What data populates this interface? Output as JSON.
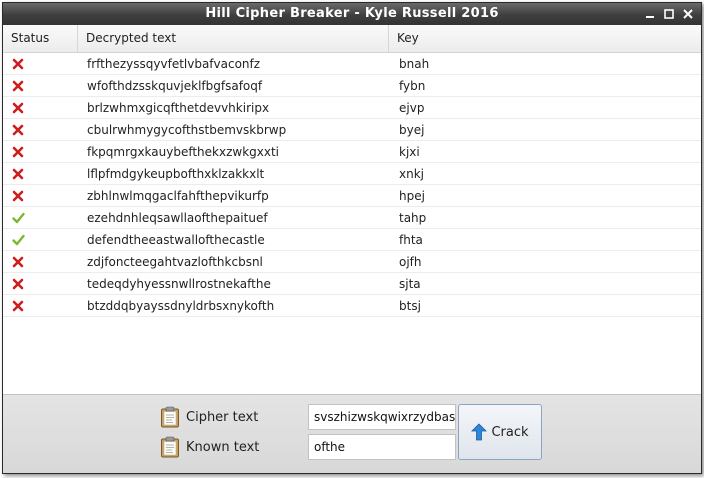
{
  "window": {
    "title": "Hill Cipher Breaker - Kyle Russell 2016"
  },
  "table": {
    "headers": {
      "status": "Status",
      "decrypted": "Decrypted text",
      "key": "Key"
    },
    "rows": [
      {
        "status": "fail",
        "decrypted": "frfthezyssqyvfetlvbafvaconfz",
        "key": "bnah"
      },
      {
        "status": "fail",
        "decrypted": "wfofthdzsskquvjeklfbgfsafoqf",
        "key": "fybn"
      },
      {
        "status": "fail",
        "decrypted": "brlzwhmxgicqfthetdevvhkiripx",
        "key": "ejvp"
      },
      {
        "status": "fail",
        "decrypted": "cbulrwhmygycofthstbemvskbrwp",
        "key": "byej"
      },
      {
        "status": "fail",
        "decrypted": "fkpqmrgxkauybefthekxzwkgxxti",
        "key": "kjxi"
      },
      {
        "status": "fail",
        "decrypted": "lflpfmdgykeupbofthxklzakkxlt",
        "key": "xnkj"
      },
      {
        "status": "fail",
        "decrypted": "zbhlnwlmqgaclfahfthepvikurfp",
        "key": "hpej"
      },
      {
        "status": "success",
        "decrypted": "ezehdnhleqsawllaofthepaituef",
        "key": "tahp"
      },
      {
        "status": "success",
        "decrypted": "defendtheeastwallofthecastle",
        "key": "fhta"
      },
      {
        "status": "fail",
        "decrypted": "zdjfoncteegahtvazlofthkcbsnl",
        "key": "ojfh"
      },
      {
        "status": "fail",
        "decrypted": "tedeqdyhyessnwllrostnekafthe",
        "key": "sjta"
      },
      {
        "status": "fail",
        "decrypted": "btzddqbyayssdnyldrbsxnykofth",
        "key": "btsj"
      }
    ]
  },
  "form": {
    "cipher_label": "Cipher text",
    "cipher_value": "svszhizwskqwixrzydbas",
    "known_label": "Known text",
    "known_value": "ofthe",
    "crack_label": "Crack"
  }
}
